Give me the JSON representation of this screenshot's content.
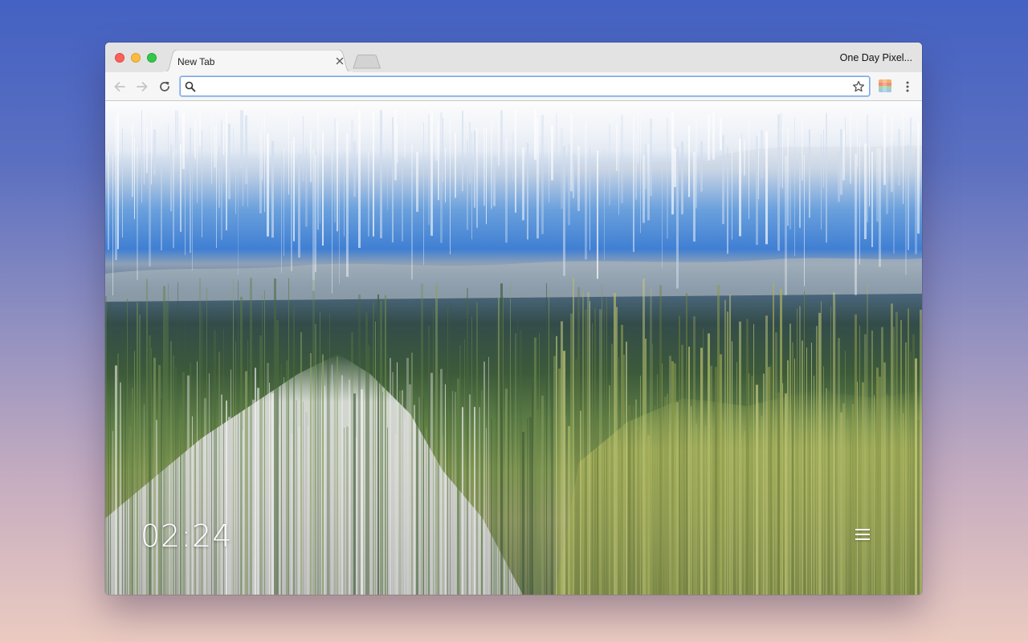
{
  "window": {
    "tab_title": "New Tab",
    "profile_name": "One Day Pixel..."
  },
  "toolbar": {
    "address_value": "",
    "address_placeholder": ""
  },
  "newtab": {
    "clock": "02:24"
  },
  "icons": {
    "traffic_close": "close-window-icon",
    "traffic_minimize": "minimize-window-icon",
    "traffic_maximize": "maximize-window-icon",
    "tab_close": "close-icon",
    "new_tab": "new-tab-icon",
    "back": "back-arrow-icon",
    "forward": "forward-arrow-icon",
    "reload": "reload-icon",
    "search": "search-icon",
    "bookmark": "star-icon",
    "extension": "extension-icon",
    "menu": "kebab-menu-icon",
    "settings_menu": "hamburger-menu-icon"
  },
  "colors": {
    "close": "#fc605b",
    "minimize": "#fdbc40",
    "maximize": "#34c84a",
    "omnibox_focus": "#7aa7e8"
  }
}
